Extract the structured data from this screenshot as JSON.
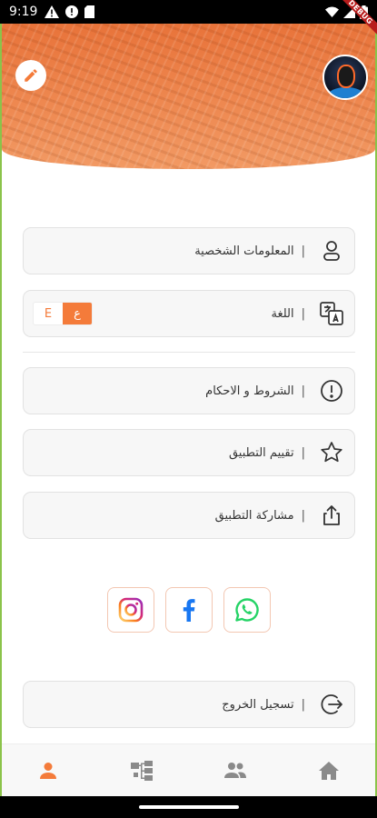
{
  "status_bar": {
    "time": "9:19",
    "icons_left": [
      "alert-triangle-icon",
      "alert-circle-icon",
      "sd-card-icon"
    ],
    "icons_right": [
      "wifi-icon",
      "signal-icon",
      "battery-icon"
    ],
    "debug_label": "DEBUG"
  },
  "header": {
    "edit_icon": "pencil-icon",
    "avatar_icon": "avatar",
    "accent_color": "#f47b3a"
  },
  "menu": {
    "personal_info": {
      "label": "المعلومات الشخصية",
      "separator": "|",
      "icon": "user-icon"
    },
    "language": {
      "label": "اللغة",
      "separator": "|",
      "icon": "translate-icon",
      "options": [
        {
          "label": "E",
          "selected": false
        },
        {
          "label": "ع",
          "selected": true
        }
      ]
    },
    "terms": {
      "label": "الشروط و الاحكام",
      "separator": "|",
      "icon": "info-circle-icon"
    },
    "rate": {
      "label": "تقييم التطبيق",
      "separator": "|",
      "icon": "star-icon"
    },
    "share": {
      "label": "مشاركة التطبيق",
      "separator": "|",
      "icon": "share-icon"
    },
    "logout": {
      "label": "تسجيل الخروج",
      "separator": "|",
      "icon": "logout-icon"
    }
  },
  "social": {
    "items": [
      {
        "name": "instagram",
        "icon": "instagram-icon",
        "color": "#e1306c"
      },
      {
        "name": "facebook",
        "icon": "facebook-icon",
        "color": "#1877f2"
      },
      {
        "name": "whatsapp",
        "icon": "whatsapp-icon",
        "color": "#25d366"
      }
    ]
  },
  "bottom_nav": {
    "active_color": "#f47b3a",
    "inactive_color": "#8a8a8a",
    "items": [
      {
        "icon": "profile-icon",
        "active": true
      },
      {
        "icon": "hierarchy-icon",
        "active": false
      },
      {
        "icon": "group-icon",
        "active": false
      },
      {
        "icon": "home-icon",
        "active": false
      }
    ]
  }
}
